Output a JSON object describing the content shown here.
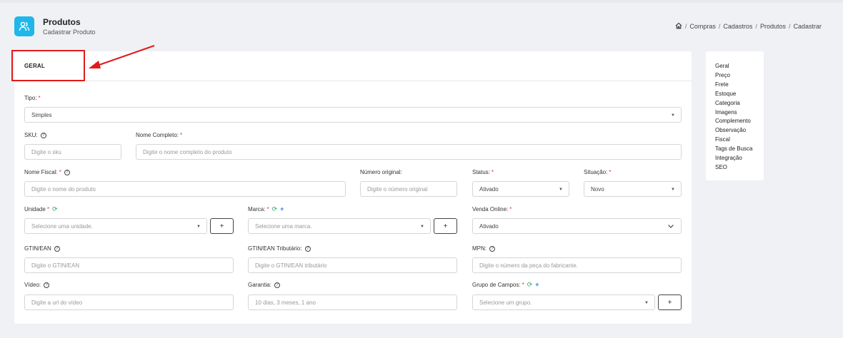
{
  "header": {
    "title": "Produtos",
    "subtitle": "Cadastrar Produto",
    "icon": "users-icon",
    "accent_color": "#1fb7ea"
  },
  "breadcrumb": {
    "home_icon": "home-icon",
    "items": [
      "Compras",
      "Cadastros",
      "Produtos",
      "Cadastrar"
    ],
    "separator": "/"
  },
  "card": {
    "section_title": "GERAL"
  },
  "annotation": {
    "color": "#e01b1b"
  },
  "form": {
    "tipo": {
      "label": "Tipo:",
      "required": "*",
      "value": "Simples"
    },
    "sku": {
      "label": "SKU:",
      "placeholder": "Digite o sku"
    },
    "nome_completo": {
      "label": "Nome Completo:",
      "required": "*",
      "placeholder": "Digite o nome completo do produto"
    },
    "nome_fiscal": {
      "label": "Nome Fiscal:",
      "required": "*",
      "placeholder": "Digite o nome do produto"
    },
    "numero_original": {
      "label": "Número original:",
      "placeholder": "Digite o número original"
    },
    "status": {
      "label": "Status:",
      "required": "*",
      "value": "Ativado"
    },
    "situacao": {
      "label": "Situação:",
      "required": "*",
      "value": "Novo"
    },
    "unidade": {
      "label": "Unidade",
      "required": "*",
      "placeholder": "Selecione uma unidade.",
      "add_label": "+"
    },
    "marca": {
      "label": "Marca:",
      "required": "*",
      "placeholder": "Selecione uma marca.",
      "add_label": "+"
    },
    "venda_online": {
      "label": "Venda Online:",
      "required": "*",
      "value": "Ativado"
    },
    "gtin": {
      "label": "GTIN/EAN",
      "placeholder": "Digite o GTIN/EAN"
    },
    "gtin_tributario": {
      "label": "GTIN/EAN Tributário:",
      "placeholder": "Digite o GTIN/EAN tributário"
    },
    "mpn": {
      "label": "MPN:",
      "placeholder": "Digite o número da peça do fabricante."
    },
    "video": {
      "label": "Vídeo:",
      "placeholder": "Digite a url do vídeo"
    },
    "garantia": {
      "label": "Garantia:",
      "placeholder": "10 dias, 3 meses, 1 ano"
    },
    "grupo_campos": {
      "label": "Grupo de Campos:",
      "required": "*",
      "placeholder": "Selecione um grupo.",
      "add_label": "+"
    }
  },
  "side_nav": {
    "items": [
      "Geral",
      "Preço",
      "Frete",
      "Estoque",
      "Categoria",
      "Imagens",
      "Complemento",
      "Observação",
      "Fiscal",
      "Tags de Busca",
      "Integração",
      "SEO"
    ]
  }
}
